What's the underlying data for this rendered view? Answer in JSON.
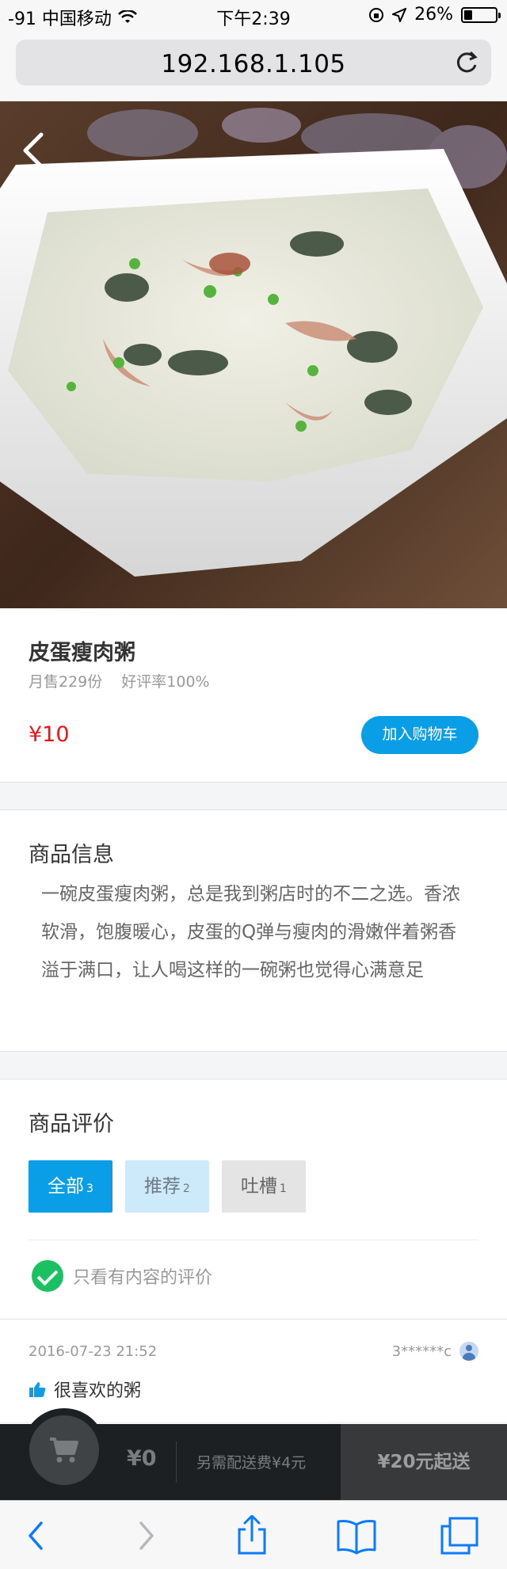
{
  "status_bar": {
    "carrier": "-91 中国移动",
    "time": "下午2:39",
    "battery": "26%",
    "battery_level": 0.26
  },
  "browser": {
    "url": "192.168.1.105"
  },
  "product": {
    "name": "皮蛋瘦肉粥",
    "monthly_sales": "月售229份",
    "rating": "好评率100%",
    "price": "¥10",
    "add_to_cart": "加入购物车"
  },
  "description": {
    "title": "商品信息",
    "text": "一碗皮蛋瘦肉粥，总是我到粥店时的不二之选。香浓软滑，饱腹暖心，皮蛋的Q弹与瘦肉的滑嫩伴着粥香溢于满口，让人喝这样的一碗粥也觉得心满意足"
  },
  "reviews": {
    "title": "商品评价",
    "tabs": [
      {
        "label": "全部",
        "count": "3"
      },
      {
        "label": "推荐",
        "count": "2"
      },
      {
        "label": "吐槽",
        "count": "1"
      }
    ],
    "filter_label": "只看有内容的评价",
    "items": [
      {
        "date": "2016-07-23 21:52",
        "user": "3******c",
        "text": "很喜欢的粥"
      }
    ]
  },
  "cart": {
    "total": "¥0",
    "delivery_fee": "另需配送费¥4元",
    "min_order": "¥20元起送"
  },
  "colors": {
    "accent": "#0a9ee6",
    "price": "#f01414",
    "check": "#19c160",
    "cart_bg": "#1d2023"
  }
}
